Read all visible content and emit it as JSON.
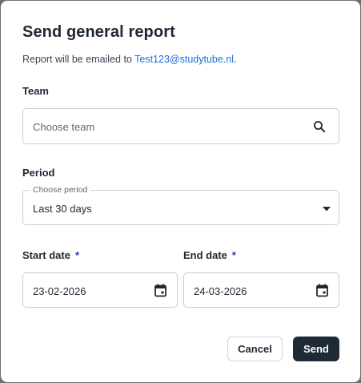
{
  "dialog": {
    "title": "Send general report",
    "subtitle_prefix": "Report will be emailed to ",
    "email": "Test123@studytube.nl",
    "subtitle_suffix": "."
  },
  "team": {
    "label": "Team",
    "placeholder": "Choose team",
    "icon": "search-icon"
  },
  "period": {
    "label": "Period",
    "floating_label": "Choose period",
    "selected": "Last 30 days",
    "icon": "caret-down-icon"
  },
  "start_date": {
    "label": "Start date",
    "required_marker": "*",
    "value": "23-02-2026",
    "icon": "calendar-icon"
  },
  "end_date": {
    "label": "End date",
    "required_marker": "*",
    "value": "24-03-2026",
    "icon": "calendar-icon"
  },
  "actions": {
    "cancel_label": "Cancel",
    "send_label": "Send"
  },
  "colors": {
    "primary_button": "#1e2a35",
    "link": "#1c6fd8",
    "required": "#1c3fb8"
  }
}
